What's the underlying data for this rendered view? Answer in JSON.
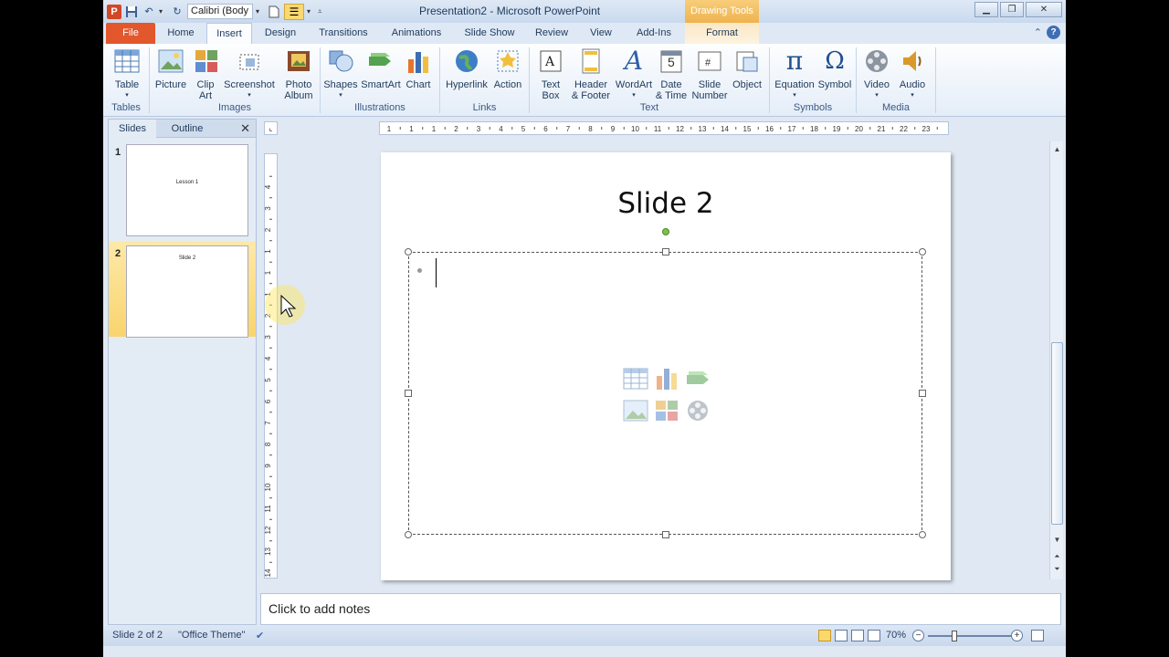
{
  "window": {
    "title": "Presentation2 - Microsoft PowerPoint",
    "context_tab": "Drawing Tools",
    "quick_access": {
      "font": "Calibri (Body"
    }
  },
  "tabs": [
    "File",
    "Home",
    "Insert",
    "Design",
    "Transitions",
    "Animations",
    "Slide Show",
    "Review",
    "View",
    "Add-Ins",
    "Format"
  ],
  "active_tab": "Insert",
  "ribbon": {
    "buttons": {
      "table": "Table",
      "picture": "Picture",
      "clipart": "Clip\nArt",
      "screenshot": "Screenshot",
      "photoalbum": "Photo\nAlbum",
      "shapes": "Shapes",
      "smartart": "SmartArt",
      "chart": "Chart",
      "hyperlink": "Hyperlink",
      "action": "Action",
      "textbox": "Text\nBox",
      "headerfooter": "Header\n& Footer",
      "wordart": "WordArt",
      "datetime": "Date\n& Time",
      "slidenumber": "Slide\nNumber",
      "object": "Object",
      "equation": "Equation",
      "symbol": "Symbol",
      "video": "Video",
      "audio": "Audio"
    },
    "groups": {
      "tables": "Tables",
      "images": "Images",
      "illustrations": "Illustrations",
      "links": "Links",
      "text": "Text",
      "symbols": "Symbols",
      "media": "Media"
    },
    "glyphs": {
      "equation": "π",
      "symbol": "Ω",
      "wordart": "A",
      "datetime": "5"
    }
  },
  "left_panel": {
    "tabs": [
      "Slides",
      "Outline"
    ],
    "close": "✕",
    "slides": [
      {
        "number": "1",
        "title": "Lesson  1"
      },
      {
        "number": "2",
        "title": "Slide 2"
      }
    ]
  },
  "ruler": {
    "horizontal": "·1·|·1·|·1·|·2·|·3·|·4·|·5·|·6·|·7·|·8·|·9·|·10·|·11·|·12·|·13·|·14·|·15·|·16·|·17·|·18·|·19·|·20·|·21·|·22·|·23·",
    "vertical": "·14·|·13·|·12·|·11·|·10·|·9·|·8·|·7·|·6·|·5·|·4·|·3·|·2·|·1·|·1·|·1·|·2·|·3·|·4·"
  },
  "slide": {
    "title": "Slide 2"
  },
  "notes": {
    "placeholder": "Click to add notes"
  },
  "status_bar": {
    "slide_info": "Slide 2 of 2",
    "theme": "\"Office Theme\"",
    "zoom": "70%"
  },
  "colors": {
    "file_tab": "#e2572b",
    "selection": "#f9d46e",
    "context_tab": "#eeb34f"
  }
}
